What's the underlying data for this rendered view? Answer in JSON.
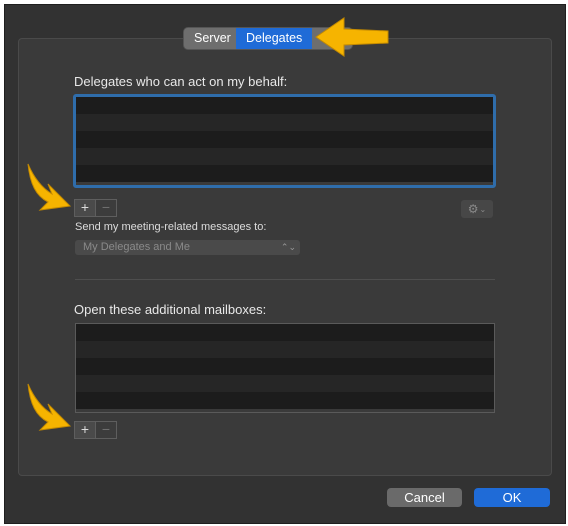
{
  "tabs": {
    "server": "Server",
    "delegates": "Delegates"
  },
  "delegates_section": {
    "heading": "Delegates who can act on my behalf:",
    "send_label": "Send my meeting-related messages to:",
    "send_value": "My Delegates and Me"
  },
  "mailboxes_section": {
    "heading": "Open these additional mailboxes:"
  },
  "controls": {
    "add": "+",
    "remove": "−",
    "gear_icon": "gear-icon"
  },
  "footer": {
    "cancel": "Cancel",
    "ok": "OK"
  },
  "colors": {
    "accent": "#1f6bd7",
    "annotation_arrow": "#f6b400"
  }
}
